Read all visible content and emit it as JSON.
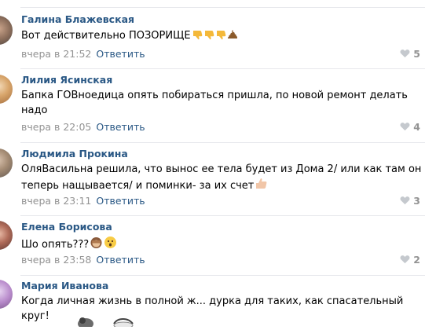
{
  "comments": [
    {
      "author": "Галина Блажевская",
      "text": "Вот действительно ПОЗОРИЩЕ",
      "emojis": [
        "thumbs-down",
        "thumbs-down",
        "thumbs-down",
        "poop"
      ],
      "time": "вчера в 21:52",
      "reply_label": "Ответить",
      "likes": "5"
    },
    {
      "author": "Лилия Ясинская",
      "text": "Бапка ГОВноедица опять побираться пришла, по новой ремонт делать надо",
      "time": "вчера в 22:05",
      "reply_label": "Ответить",
      "likes": "4"
    },
    {
      "author": "Людмила Прокина",
      "text": "ОляВасильна решила, что вынос ее тела будет из Дома 2/ или как там он теперь нащывается/ и поминки- за их счет",
      "emojis": [
        "thumbs-up"
      ],
      "time": "вчера в 23:11",
      "reply_label": "Ответить",
      "likes": "3"
    },
    {
      "author": "Елена Борисова",
      "text": "Шо опять???",
      "emojis": [
        "see-no-evil-monkey",
        "hushed-face"
      ],
      "time": "вчера в 23:58",
      "reply_label": "Ответить",
      "likes": "2"
    },
    {
      "author": "Мария Иванова",
      "text": "Когда личная жизнь в полной ж... дурка для таких, как спасательный круг!"
    }
  ],
  "colors": {
    "link": "#2a5885",
    "meta": "#939393",
    "separator": "#e7e8ec"
  }
}
